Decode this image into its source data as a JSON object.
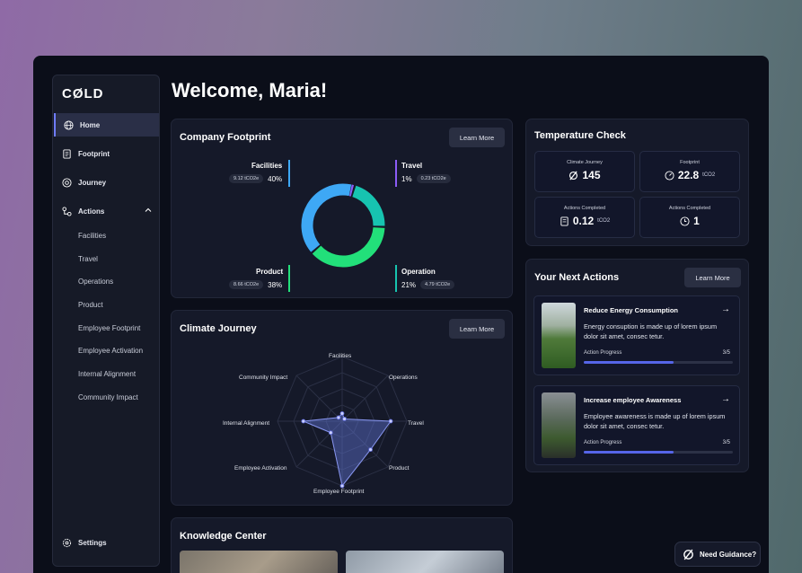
{
  "app": {
    "logo": "CØLD"
  },
  "page": {
    "title": "Welcome, Maria!"
  },
  "sidebar": {
    "items": [
      {
        "label": "Home",
        "icon": "globe-icon"
      },
      {
        "label": "Footprint",
        "icon": "document-icon"
      },
      {
        "label": "Journey",
        "icon": "journey-icon"
      },
      {
        "label": "Actions",
        "icon": "actions-icon"
      }
    ],
    "subitems": [
      "Facilities",
      "Travel",
      "Operations",
      "Product",
      "Employee Footprint",
      "Employee Activation",
      "Internal Alignment",
      "Community Impact"
    ],
    "settings": "Settings"
  },
  "footprint": {
    "title": "Company Footprint",
    "button": "Learn More",
    "segments": [
      {
        "name": "Facilities",
        "percent": "40%",
        "value": "9.12 tCO2e",
        "color": "#3ea8f5"
      },
      {
        "name": "Travel",
        "percent": "1%",
        "value": "0.23 tCO2e",
        "color": "#8b5cf6"
      },
      {
        "name": "Product",
        "percent": "38%",
        "value": "8.66 tCO2e",
        "color": "#22e07a"
      },
      {
        "name": "Operation",
        "percent": "21%",
        "value": "4.79 tCO2e",
        "color": "#17c4b0"
      }
    ]
  },
  "journey": {
    "title": "Climate Journey",
    "button": "Learn More",
    "axes": [
      "Facilities",
      "Operations",
      "Travel",
      "Product",
      "Employee Footprint",
      "Employee Activation",
      "Internal Alignment",
      "Community Impact"
    ],
    "values": [
      0.12,
      0.05,
      0.75,
      0.62,
      1.0,
      0.25,
      0.6,
      0.08
    ]
  },
  "temperature": {
    "title": "Temperature Check",
    "stats": [
      {
        "label": "Climate Journey",
        "value": "145",
        "unit": "",
        "icon": "cold-logo-icon"
      },
      {
        "label": "Footprint",
        "value": "22.8",
        "unit": "tCO2",
        "icon": "gauge-icon"
      },
      {
        "label": "Actions Completed",
        "value": "0.12",
        "unit": "tCO2",
        "icon": "document-icon"
      },
      {
        "label": "Actions Completed",
        "value": "1",
        "unit": "",
        "icon": "clock-icon"
      }
    ]
  },
  "next_actions": {
    "title": "Your Next Actions",
    "button": "Learn More",
    "items": [
      {
        "title": "Reduce Energy Consumption",
        "desc": "Energy consuption is made up of lorem ipsum dolor sit amet, consec tetur.",
        "progress_label": "Action Progress",
        "progress": "3/5",
        "fraction": 0.6
      },
      {
        "title": "Increase employee Awareness",
        "desc": "Employee awareness is made up of lorem ipsum dolor sit amet, consec tetur.",
        "progress_label": "Action Progress",
        "progress": "3/5",
        "fraction": 0.6
      }
    ]
  },
  "knowledge": {
    "title": "Knowledge Center"
  },
  "guidance": {
    "label": "Need Guidance?"
  }
}
